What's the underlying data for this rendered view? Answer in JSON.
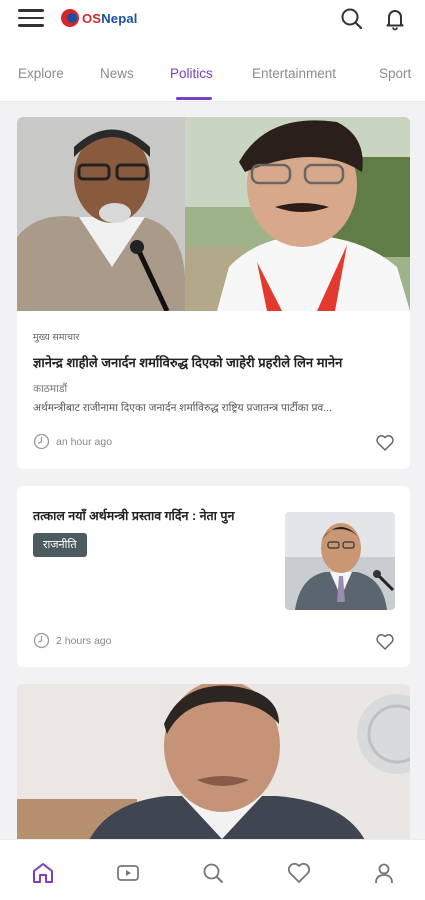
{
  "app": {
    "logo_text_os": "OS",
    "logo_text_nepal": "Nepal"
  },
  "colors": {
    "accent": "#7b3fc4",
    "tag_bg": "#4d5b60",
    "logo_red": "#d62828",
    "logo_blue": "#1d4fa0"
  },
  "header": {
    "icons": [
      "menu-icon",
      "search-icon",
      "bell-icon"
    ]
  },
  "tabs": [
    {
      "label": "Explore"
    },
    {
      "label": "News"
    },
    {
      "label": "Politics",
      "active": true
    },
    {
      "label": "Entertainment"
    },
    {
      "label": "Sport"
    }
  ],
  "articles": [
    {
      "category": "मुख्य समाचार",
      "headline": "ज्ञानेन्द्र शाहीले जनार्दन शर्माविरुद्ध दिएको जाहेरी प्रहरीले लिन मानेन",
      "location": "काठमाडौं",
      "excerpt": "अर्थमन्त्रीबाट राजीनामा दिएका जनार्दन शर्माविरुद्ध राष्ट्रिय प्रजातन्त्र पार्टीका प्रव...",
      "time": "an hour ago"
    },
    {
      "headline": "तत्काल नयाँ अर्थमन्त्री प्रस्ताव गर्दिन : नेता पुन",
      "tag": "राजनीति",
      "time": "2 hours ago"
    }
  ],
  "bottom_nav": [
    "home-icon",
    "video-icon",
    "search-icon",
    "heart-icon",
    "profile-icon"
  ]
}
